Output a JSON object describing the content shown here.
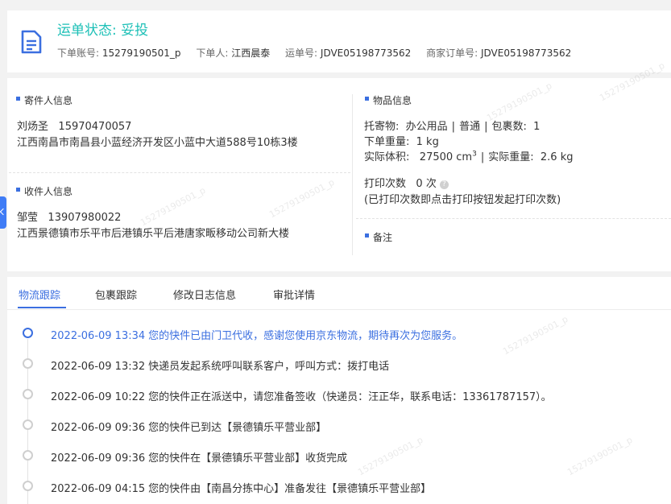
{
  "header": {
    "status_label": "运单状态: ",
    "status_value": "妥投",
    "account_label": "下单账号:",
    "account_value": "15279190501_p",
    "orderer_label": "下单人:",
    "orderer_value": "江西晨泰",
    "waybill_label": "运单号:",
    "waybill_value": "JDVE05198773562",
    "merchant_label": "商家订单号:",
    "merchant_value": "JDVE05198773562"
  },
  "sender": {
    "title": "寄件人信息",
    "name": "刘炀圣",
    "phone": "15970470057",
    "address": "江西南昌市南昌县小蓝经济开发区小蓝中大道588号10栋3楼"
  },
  "receiver": {
    "title": "收件人信息",
    "name": "邹莹",
    "phone": "13907980022",
    "address": "江西景德镇市乐平市后港镇乐平后港唐家畈移动公司新大楼"
  },
  "goods": {
    "title": "物品信息",
    "consign_label": "托寄物:",
    "consign_value": "办公用品",
    "type_value": "普通",
    "count_label": "包裹数:",
    "count_value": "1",
    "order_weight_label": "下单重量:",
    "order_weight_value": "1 kg",
    "volume_label": "实际体积:",
    "volume_value": "27500 cm",
    "volume_exp": "3",
    "actual_weight_label": "实际重量:",
    "actual_weight_value": "2.6 kg",
    "print_label": "打印次数",
    "print_value": "0 次",
    "print_note": "(已打印次数即点击打印按钮发起打印次数)"
  },
  "remark": {
    "title": "备注"
  },
  "tabs": [
    {
      "label": "物流跟踪"
    },
    {
      "label": "包裹跟踪"
    },
    {
      "label": "修改日志信息"
    },
    {
      "label": "审批详情"
    }
  ],
  "timeline": [
    {
      "time": "2022-06-09 13:34",
      "text": "您的快件已由门卫代收，感谢您使用京东物流，期待再次为您服务。"
    },
    {
      "time": "2022-06-09 13:32",
      "text": "快递员发起系统呼叫联系客户，呼叫方式：拨打电话"
    },
    {
      "time": "2022-06-09 10:22",
      "text": "您的快件正在派送中，请您准备签收（快递员：汪正华，联系电话：13361787157）。"
    },
    {
      "time": "2022-06-09 09:36",
      "text": "您的快件已到达【景德镇乐平营业部】"
    },
    {
      "time": "2022-06-09 09:36",
      "text": "您的快件在【景德镇乐平营业部】收货完成"
    },
    {
      "time": "2022-06-09 04:15",
      "text": "您的快件由【南昌分拣中心】准备发往【景德镇乐平营业部】"
    }
  ],
  "watermark": "15279190501_p",
  "colors": {
    "status": "#1ec0b7",
    "accent": "#3b6fe0"
  }
}
